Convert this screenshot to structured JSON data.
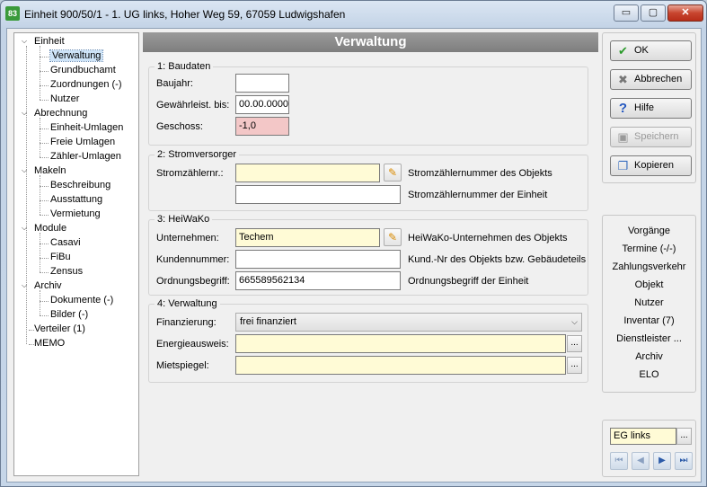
{
  "window": {
    "title": "Einheit 900/50/1 - 1. UG links, Hoher Weg 59, 67059 Ludwigshafen",
    "icon_label": "83",
    "minimize_label": "▭",
    "maximize_label": "▢",
    "close_label": "✕"
  },
  "tree": {
    "items": [
      {
        "label": "Einheit",
        "level": 0,
        "expanded": true
      },
      {
        "label": "Verwaltung",
        "level": 1,
        "selected": true
      },
      {
        "label": "Grundbuchamt",
        "level": 1
      },
      {
        "label": "Zuordnungen (-)",
        "level": 1
      },
      {
        "label": "Nutzer",
        "level": 1
      },
      {
        "label": "Abrechnung",
        "level": 0,
        "expanded": true
      },
      {
        "label": "Einheit-Umlagen",
        "level": 1
      },
      {
        "label": "Freie Umlagen",
        "level": 1
      },
      {
        "label": "Zähler-Umlagen",
        "level": 1
      },
      {
        "label": "Makeln",
        "level": 0,
        "expanded": true
      },
      {
        "label": "Beschreibung",
        "level": 1
      },
      {
        "label": "Ausstattung",
        "level": 1
      },
      {
        "label": "Vermietung",
        "level": 1
      },
      {
        "label": "Module",
        "level": 0,
        "expanded": true
      },
      {
        "label": "Casavi",
        "level": 1
      },
      {
        "label": "FiBu",
        "level": 1
      },
      {
        "label": "Zensus",
        "level": 1
      },
      {
        "label": "Archiv",
        "level": 0,
        "expanded": true
      },
      {
        "label": "Dokumente (-)",
        "level": 1
      },
      {
        "label": "Bilder (-)",
        "level": 1
      },
      {
        "label": "Verteiler (1)",
        "level": 0
      },
      {
        "label": "MEMO",
        "level": 0
      }
    ],
    "expand_glyph": "⌵"
  },
  "main": {
    "title": "Verwaltung",
    "baudaten": {
      "legend": "1: Baudaten",
      "baujahr_label": "Baujahr:",
      "baujahr_value": "",
      "gewaehr_label": "Gewährleist. bis:",
      "gewaehr_value": "00.00.0000",
      "geschoss_label": "Geschoss:",
      "geschoss_value": "-1,0"
    },
    "strom": {
      "legend": "2: Stromversorger",
      "zaehler_label": "Stromzählernr.:",
      "zaehler_obj_value": "",
      "zaehler_obj_desc": "Stromzählernummer des Objekts",
      "zaehler_einh_value": "",
      "zaehler_einh_desc": "Stromzählernummer der Einheit"
    },
    "heiwako": {
      "legend": "3: HeiWaKo",
      "unternehmen_label": "Unternehmen:",
      "unternehmen_value": "Techem",
      "unternehmen_desc": "HeiWaKo-Unternehmen des Objekts",
      "kunden_label": "Kundennummer:",
      "kunden_value": "",
      "kunden_desc": "Kund.-Nr des Objekts bzw. Gebäudeteils",
      "ordnung_label": "Ordnungsbegriff:",
      "ordnung_value": "665589562134",
      "ordnung_desc": "Ordnungsbegriff der Einheit"
    },
    "verwaltung": {
      "legend": "4: Verwaltung",
      "finanz_label": "Finanzierung:",
      "finanz_value": "frei finanziert",
      "energie_label": "Energieausweis:",
      "energie_value": "",
      "miet_label": "Mietspiegel:",
      "miet_value": "",
      "dots_label": "..."
    }
  },
  "buttons": {
    "ok": "OK",
    "abbrechen": "Abbrechen",
    "hilfe": "Hilfe",
    "speichern": "Speichern",
    "kopieren": "Kopieren"
  },
  "links": [
    "Vorgänge",
    "Termine (-/-)",
    "Zahlungsverkehr",
    "Objekt",
    "Nutzer",
    "Inventar (7)",
    "Dienstleister ...",
    "Archiv",
    "ELO"
  ],
  "nav": {
    "current": "EG links",
    "dots_label": "...",
    "first": "⏮",
    "prev": "◀",
    "next": "▶",
    "last": "⏭"
  },
  "colors": {
    "header_bg": "#8a8a8a",
    "input_yellow": "#fffbd6",
    "input_red": "#f3c7c7",
    "selection": "#cde3f7"
  }
}
